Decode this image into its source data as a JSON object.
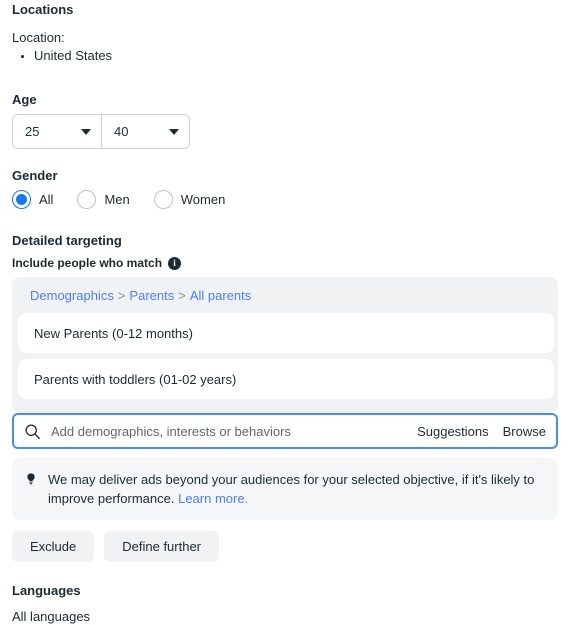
{
  "locations": {
    "title": "Locations",
    "label": "Location:",
    "items": [
      "United States"
    ]
  },
  "age": {
    "title": "Age",
    "min": "25",
    "max": "40"
  },
  "gender": {
    "title": "Gender",
    "options": [
      {
        "label": "All",
        "selected": true
      },
      {
        "label": "Men",
        "selected": false
      },
      {
        "label": "Women",
        "selected": false
      }
    ]
  },
  "detailed_targeting": {
    "title": "Detailed targeting",
    "subtitle": "Include people who match",
    "info_icon": "info-icon",
    "breadcrumb": [
      "Demographics",
      "Parents",
      "All parents"
    ],
    "breadcrumb_separator": ">",
    "selected": [
      "New Parents (0-12 months)",
      "Parents with toddlers (01-02 years)"
    ],
    "search": {
      "icon": "search-icon",
      "placeholder": "Add demographics, interests or behaviors",
      "value": "",
      "suggestions_label": "Suggestions",
      "browse_label": "Browse"
    },
    "notice": {
      "icon": "lightbulb-icon",
      "text": "We may deliver ads beyond your audiences for your selected objective, if it's likely to improve performance.",
      "link": "Learn more."
    },
    "exclude_label": "Exclude",
    "define_further_label": "Define further"
  },
  "languages": {
    "title": "Languages",
    "value": "All languages"
  },
  "colors": {
    "accent": "#1877f2",
    "link": "#4a7dfc",
    "text": "#1c2b33",
    "panel": "#f1f2f3",
    "focus_border": "#4a8cf7"
  }
}
